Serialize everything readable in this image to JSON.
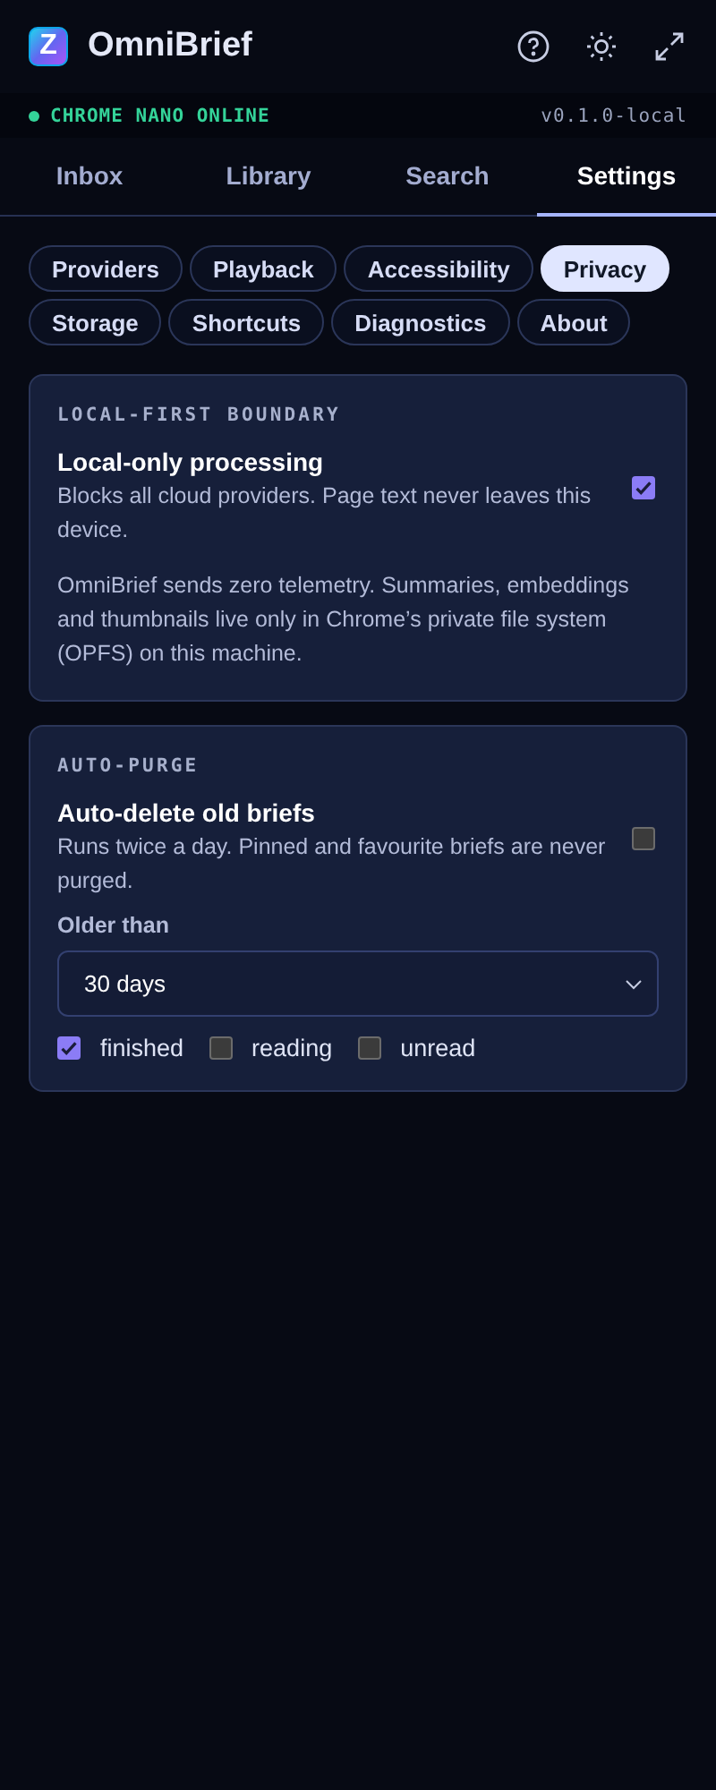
{
  "app": {
    "logo_letter": "Z",
    "title": "OmniBrief"
  },
  "status_bar": {
    "status": "CHROME NANO ONLINE",
    "online": true,
    "version": "v0.1.0-local"
  },
  "tabs": [
    {
      "label": "Inbox",
      "selected": false
    },
    {
      "label": "Library",
      "selected": false
    },
    {
      "label": "Search",
      "selected": false
    },
    {
      "label": "Settings",
      "selected": true
    }
  ],
  "settings_sections": [
    {
      "label": "Providers",
      "selected": false
    },
    {
      "label": "Playback",
      "selected": false
    },
    {
      "label": "Accessibility",
      "selected": false
    },
    {
      "label": "Privacy",
      "selected": true
    },
    {
      "label": "Storage",
      "selected": false
    },
    {
      "label": "Shortcuts",
      "selected": false
    },
    {
      "label": "Diagnostics",
      "selected": false
    },
    {
      "label": "About",
      "selected": false
    }
  ],
  "cards": [
    {
      "heading": "LOCAL-FIRST BOUNDARY",
      "toggle": {
        "title": "Local-only processing",
        "description": "Blocks all cloud providers. Page text never leaves this device.",
        "checked": true
      },
      "note": "OmniBrief sends zero telemetry. Summaries, embeddings and thumbnails live only in Chrome’s private file system (OPFS) on this machine."
    },
    {
      "heading": "AUTO-PURGE",
      "toggle": {
        "title": "Auto-delete old briefs",
        "description": "Runs twice a day. Pinned and favourite briefs are never purged.",
        "checked": false
      },
      "select": {
        "label": "Older than",
        "value": "30 days"
      },
      "filters": [
        {
          "label": "finished",
          "checked": true
        },
        {
          "label": "reading",
          "checked": false
        },
        {
          "label": "unread",
          "checked": false
        }
      ]
    }
  ]
}
